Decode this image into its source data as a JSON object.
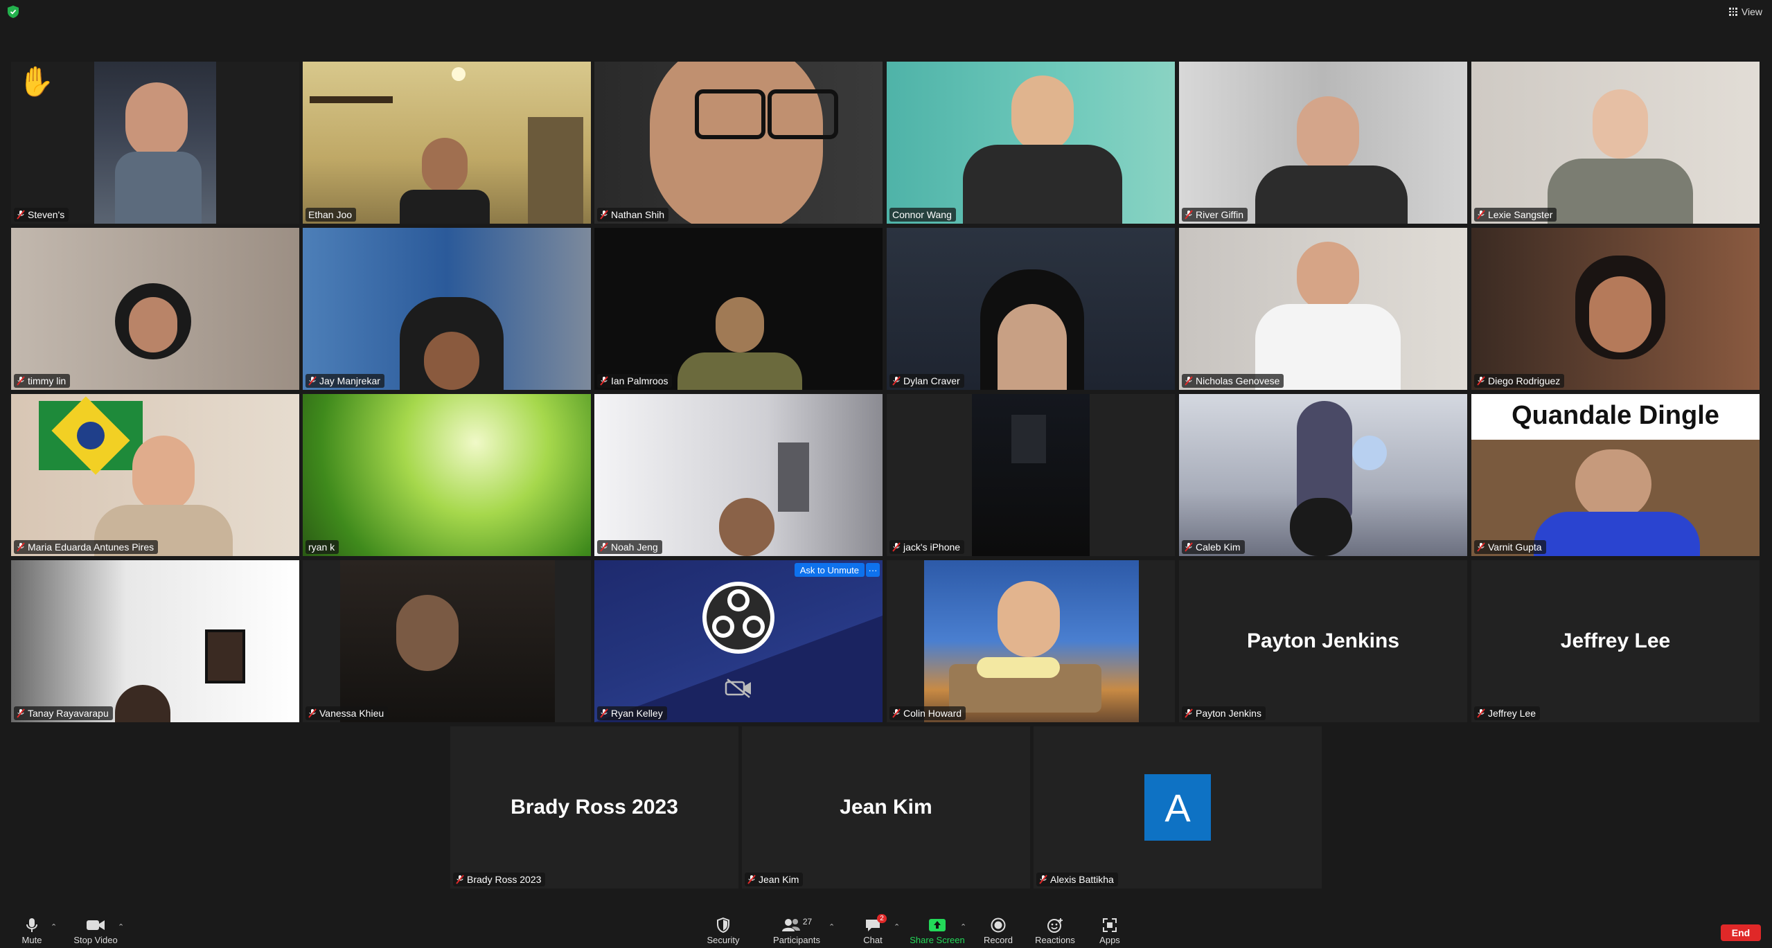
{
  "header": {
    "view_label": "View"
  },
  "colors": {
    "active_speaker": "#c3e05a",
    "muted_mic": "#e02828",
    "share_green": "#23d959",
    "end_red": "#e02828",
    "blue": "#0e72ed"
  },
  "tiles": [
    {
      "name": "Steven's"
    },
    {
      "name": "Ethan Joo"
    },
    {
      "name": "Nathan Shih"
    },
    {
      "name": "Connor Wang"
    },
    {
      "name": "River Giffin"
    },
    {
      "name": "Lexie Sangster"
    },
    {
      "name": "timmy lin"
    },
    {
      "name": "Jay Manjrekar"
    },
    {
      "name": "Ian Palmroos"
    },
    {
      "name": "Dylan Craver"
    },
    {
      "name": "Nicholas Genovese"
    },
    {
      "name": "Diego Rodriguez"
    },
    {
      "name": "Maria Eduarda Antunes Pires"
    },
    {
      "name": "ryan k"
    },
    {
      "name": "Noah Jeng"
    },
    {
      "name": "jack's iPhone"
    },
    {
      "name": "Caleb Kim"
    },
    {
      "name": "Varnit Gupta",
      "overlay_text": "Quandale Dingle"
    },
    {
      "name": "Tanay Rayavarapu"
    },
    {
      "name": "Vanessa Khieu"
    },
    {
      "name": "Ryan Kelley",
      "ask_unmute": "Ask to Unmute",
      "more": "···"
    },
    {
      "name": "Colin Howard"
    },
    {
      "name": "Payton Jenkins",
      "display": "Payton Jenkins"
    },
    {
      "name": "Jeffrey Lee",
      "display": "Jeffrey Lee"
    },
    {
      "name": "Brady Ross 2023",
      "display": "Brady Ross 2023"
    },
    {
      "name": "Jean Kim",
      "display": "Jean Kim"
    },
    {
      "name": "Alexis Battikha",
      "avatar_letter": "A"
    }
  ],
  "toolbar": {
    "mute": "Mute",
    "stop_video": "Stop Video",
    "security": "Security",
    "participants": "Participants",
    "participants_count": "27",
    "chat": "Chat",
    "chat_badge": "2",
    "share_screen": "Share Screen",
    "record": "Record",
    "reactions": "Reactions",
    "apps": "Apps",
    "end": "End"
  }
}
